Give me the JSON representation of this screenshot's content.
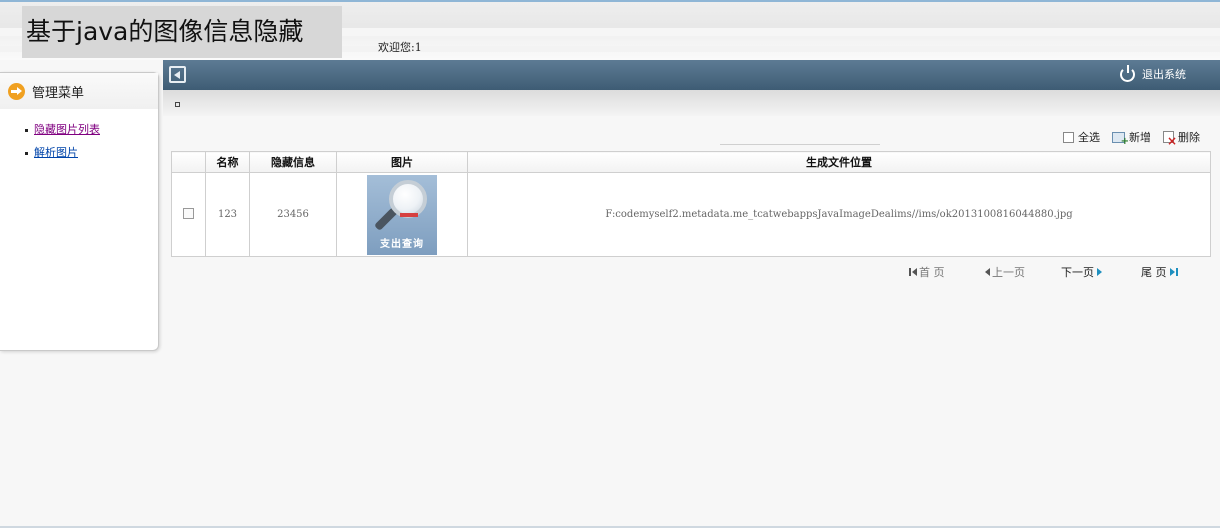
{
  "header": {
    "title": "基于java的图像信息隐藏",
    "welcome": "欢迎您:1"
  },
  "topbar": {
    "logout_label": "退出系统"
  },
  "sidebar": {
    "title": "管理菜单",
    "items": [
      {
        "label": "隐藏图片列表"
      },
      {
        "label": "解析图片"
      }
    ]
  },
  "toolbar": {
    "select_all": "全选",
    "add": "新增",
    "delete": "删除"
  },
  "table": {
    "columns": [
      "",
      "名称",
      "隐藏信息",
      "图片",
      "生成文件位置"
    ],
    "rows": [
      {
        "name": "123",
        "hidden_info": "23456",
        "image_caption": "支出查询",
        "file_path": "F:codemyself2.metadata.me_tcatwebappsJavaImageDealims//ims/ok2013100816044880.jpg"
      }
    ]
  },
  "pagination": {
    "first": "首 页",
    "prev": "上一页",
    "next": "下一页",
    "last": "尾 页"
  },
  "colors": {
    "topbar": "#4a687f",
    "accent_orange": "#f0a020",
    "link_visited": "#800080",
    "link": "#0044aa"
  }
}
